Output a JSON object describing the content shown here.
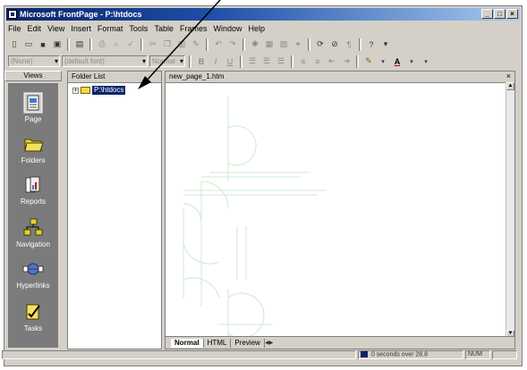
{
  "window": {
    "title": "Microsoft FrontPage - P:\\htdocs",
    "btn_min": "_",
    "btn_max": "□",
    "btn_close": "×"
  },
  "menu": [
    "File",
    "Edit",
    "View",
    "Insert",
    "Format",
    "Tools",
    "Table",
    "Frames",
    "Window",
    "Help"
  ],
  "formatting": {
    "style_value": "(None)",
    "font_value": "(default font)",
    "size_value": "Normal"
  },
  "views": {
    "header": "Views",
    "items": [
      {
        "label": "Page",
        "icon": "page-icon"
      },
      {
        "label": "Folders",
        "icon": "folders-icon"
      },
      {
        "label": "Reports",
        "icon": "reports-icon"
      },
      {
        "label": "Navigation",
        "icon": "navigation-icon"
      },
      {
        "label": "Hyperlinks",
        "icon": "hyperlinks-icon"
      },
      {
        "label": "Tasks",
        "icon": "tasks-icon"
      }
    ]
  },
  "folder_list": {
    "header": "Folder List",
    "root": "P:\\htdocs"
  },
  "editor": {
    "tab_title": "new_page_1.htm",
    "close": "×"
  },
  "page_tabs": [
    {
      "label": "Normal",
      "active": true
    },
    {
      "label": "HTML",
      "active": false
    },
    {
      "label": "Preview",
      "active": false
    }
  ],
  "status": {
    "download_time": "0 seconds over 28.8",
    "num": "NUM"
  }
}
